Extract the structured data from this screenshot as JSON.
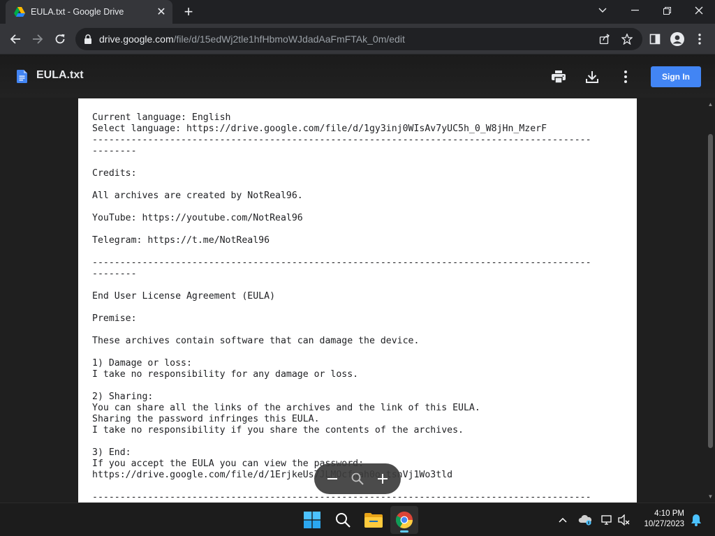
{
  "browser": {
    "tab": {
      "title": "EULA.txt - Google Drive",
      "icon": "google-drive-icon"
    },
    "address": {
      "host": "drive.google.com",
      "path": "/file/d/15edWj2tle1hfHbmoWJdadAaFmFTAk_0m/edit"
    }
  },
  "viewer": {
    "file_name": "EULA.txt",
    "sign_in_label": "Sign In",
    "accent_color": "#4285f4",
    "document_lines": [
      "Current language: English",
      "Select language: https://drive.google.com/file/d/1gy3inj0WIsAv7yUC5h_0_W8jHn_MzerF",
      "------------------------------------------------------------------------------------------",
      "--------",
      "",
      "Credits:",
      "",
      "All archives are created by NotReal96.",
      "",
      "YouTube: https://youtube.com/NotReal96",
      "",
      "Telegram: https://t.me/NotReal96",
      "",
      "------------------------------------------------------------------------------------------",
      "--------",
      "",
      "End User License Agreement (EULA)",
      "",
      "Premise:",
      "",
      "These archives contain software that can damage the device.",
      "",
      "1) Damage or loss:",
      "I take no responsibility for any damage or loss.",
      "",
      "2) Sharing:",
      "You can share all the links of the archives and the link of this EULA.",
      "Sharing the password infringes this EULA.",
      "I take no responsibility if you share the contents of the archives.",
      "",
      "3) End:",
      "If you accept the EULA you can view the password:",
      "https://drive.google.com/file/d/1ErjkeUs7JLMOcfnah0o-tsnVj1Wo3tld",
      "",
      "------------------------------------------------------------------------------------------"
    ]
  },
  "taskbar": {
    "time": "4:10 PM",
    "date": "10/27/2023"
  }
}
